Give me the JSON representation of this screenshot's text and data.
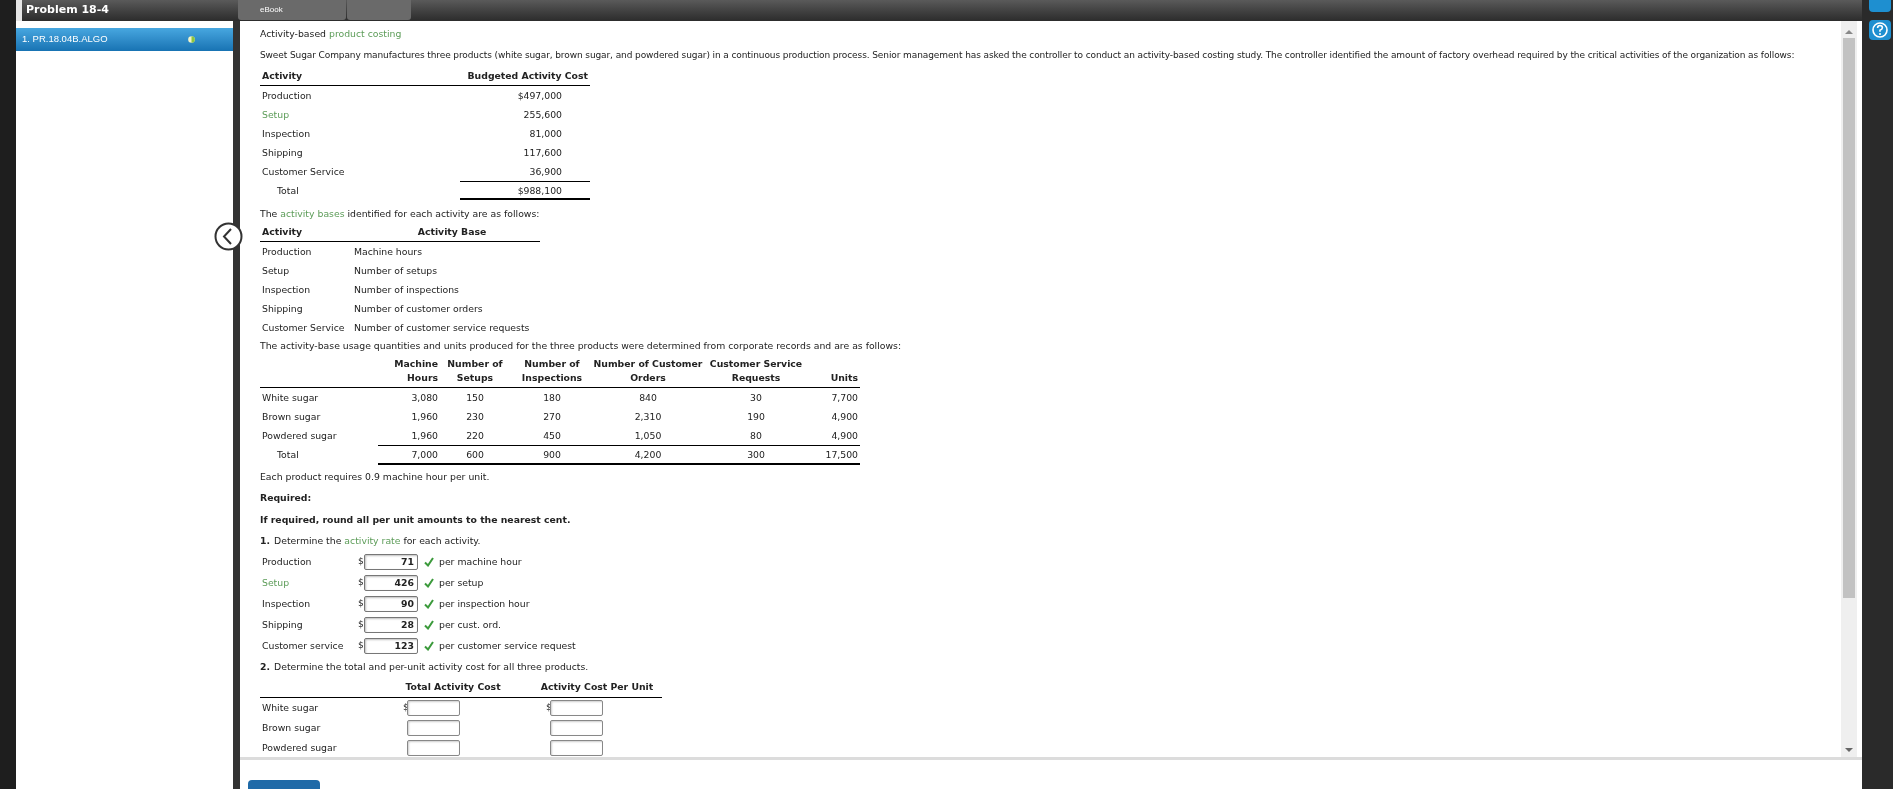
{
  "header": {
    "title": "Problem 18-4",
    "tabs": [
      {
        "label": "eBook",
        "selected": false
      }
    ]
  },
  "sidebar": {
    "items": [
      {
        "label": "1. PR.18.04B.ALGO",
        "selected": true
      }
    ]
  },
  "intro": [
    {
      "text": "Activity-based "
    },
    {
      "text": "product costing",
      "link": true
    }
  ],
  "description": [
    {
      "text": "Sweet Sugar Company manufactures three products (white sugar, brown sugar, and powdered sugar) in a continuous production process. Senior management has asked the controller to conduct an activity-based costing study. The controller identified the amount of factory overhead required by the critical activities of the organization as follows:"
    }
  ],
  "cost_table": {
    "columns": [
      "Activity",
      "Budgeted Activity Cost"
    ],
    "rows": [
      {
        "activity": "Production",
        "cost": "$497,000",
        "link": false
      },
      {
        "activity": "Setup",
        "cost": "255,600",
        "link": true
      },
      {
        "activity": "Inspection",
        "cost": "81,000",
        "link": false
      },
      {
        "activity": "Shipping",
        "cost": "117,600",
        "link": false
      },
      {
        "activity": "Customer Service",
        "cost": "36,900",
        "link": false
      }
    ],
    "total": {
      "label": "Total",
      "cost": "$988,100"
    }
  },
  "bases_intro": [
    {
      "text": "The "
    },
    {
      "text": "activity bases",
      "link": true
    },
    {
      "text": " identified for each activity are as follows:"
    }
  ],
  "base_table": {
    "columns": [
      "Activity",
      "Activity Base"
    ],
    "rows": [
      {
        "activity": "Production",
        "base": "Machine hours"
      },
      {
        "activity": "Setup",
        "base": "Number of setups"
      },
      {
        "activity": "Inspection",
        "base": "Number of inspections"
      },
      {
        "activity": "Shipping",
        "base": "Number of customer orders"
      },
      {
        "activity": "Customer Service",
        "base": "Number of customer service requests"
      }
    ]
  },
  "usage_intro": [
    {
      "text": "The activity-base usage quantities and units produced for the three products were determined from corporate records and are as follows:"
    }
  ],
  "usage_table": {
    "columns": [
      [
        "Machine",
        "Hours"
      ],
      [
        "Number of",
        "Setups"
      ],
      [
        "Number of",
        "Inspections"
      ],
      [
        "Number of Customer",
        "Orders"
      ],
      [
        "Customer Service",
        "Requests"
      ],
      [
        "Units"
      ]
    ],
    "rows": [
      {
        "label": "White sugar",
        "values": [
          "3,080",
          "150",
          "180",
          "840",
          "30",
          "7,700"
        ]
      },
      {
        "label": "Brown sugar",
        "values": [
          "1,960",
          "230",
          "270",
          "2,310",
          "190",
          "4,900"
        ]
      },
      {
        "label": "Powdered sugar",
        "values": [
          "1,960",
          "220",
          "450",
          "1,050",
          "80",
          "4,900"
        ]
      }
    ],
    "total": {
      "label": "Total",
      "values": [
        "7,000",
        "600",
        "900",
        "4,200",
        "300",
        "17,500"
      ]
    }
  },
  "note": "Each product requires 0.9 machine hour per unit.",
  "required_heading": "Required:",
  "rounding_instruction": "If required, round all per unit amounts to the nearest cent.",
  "part1": {
    "number": "1.",
    "text": [
      {
        "text": "Determine the "
      },
      {
        "text": "activity rate",
        "link": true
      },
      {
        "text": " for each activity."
      }
    ],
    "rows": [
      {
        "label": "Production",
        "link": false,
        "currency": "$",
        "value": "71",
        "correct": true,
        "unit": "per machine hour"
      },
      {
        "label": "Setup",
        "link": true,
        "currency": "$",
        "value": "426",
        "correct": true,
        "unit": "per setup"
      },
      {
        "label": "Inspection",
        "link": false,
        "currency": "$",
        "value": "90",
        "correct": true,
        "unit": "per inspection hour"
      },
      {
        "label": "Shipping",
        "link": false,
        "currency": "$",
        "value": "28",
        "correct": true,
        "unit": "per cust. ord."
      },
      {
        "label": "Customer service",
        "link": false,
        "currency": "$",
        "value": "123",
        "correct": true,
        "unit": "per customer service request"
      }
    ]
  },
  "part2": {
    "number": "2.",
    "text": [
      {
        "text": "Determine the total and per-unit activity cost for all three products."
      }
    ],
    "columns": [
      "Total Activity Cost",
      "Activity Cost Per Unit"
    ],
    "rows": [
      {
        "label": "White sugar",
        "currency": "$"
      },
      {
        "label": "Brown sugar"
      },
      {
        "label": "Powdered sugar"
      }
    ]
  }
}
